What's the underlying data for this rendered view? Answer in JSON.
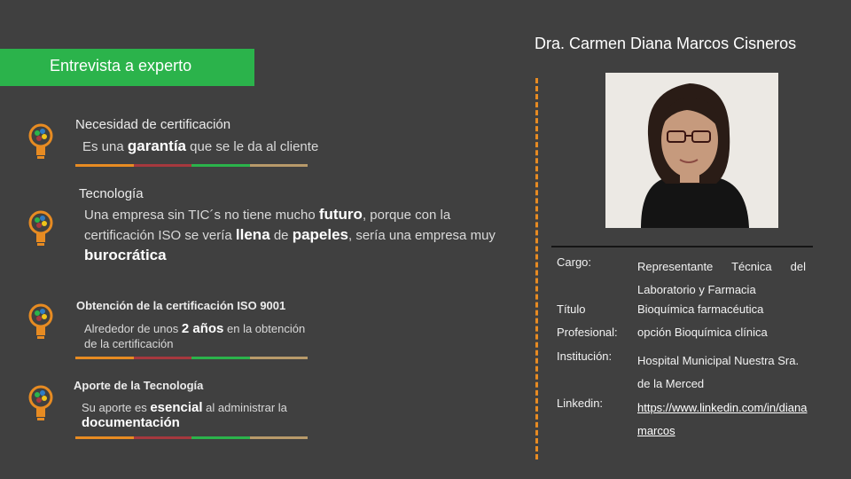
{
  "header": {
    "banner_text": "Entrevista a experto",
    "expert_name": "Dra. Carmen Diana Marcos Cisneros"
  },
  "colors": {
    "background": "#404040",
    "banner": "#2bb34b",
    "divider": "#e78b22",
    "stripe": [
      "#e78b22",
      "#a6383e",
      "#2bb34b",
      "#b89a6a"
    ]
  },
  "icons": [
    "lightbulb-icon",
    "lightbulb-icon",
    "lightbulb-icon",
    "lightbulb-icon"
  ],
  "topics": [
    {
      "title": "Necesidad de certificación",
      "parts": [
        "Es una ",
        "garantía",
        " que se le da al cliente"
      ]
    },
    {
      "title": "Tecnología",
      "parts": [
        "Una empresa sin TIC´s no tiene mucho ",
        "futuro",
        ", porque con la certificación ISO se vería ",
        "llena",
        " de ",
        "papeles",
        ", sería una empresa muy ",
        "burocrática"
      ]
    },
    {
      "title": "Obtención de la certificación ISO 9001",
      "parts": [
        "Alrededor de unos ",
        "2 años",
        " en la obtención de la certificación"
      ]
    },
    {
      "title": "Aporte de la Tecnología",
      "parts": [
        "Su aporte es ",
        "esencial",
        " al administrar la ",
        "documentación"
      ]
    }
  ],
  "profile": {
    "cargo_label": "Cargo:",
    "cargo_value": "Representante Técnica del Laboratorio y Farmacia",
    "titulo_label": "Título",
    "titulo_value": "Bioquímica farmacéutica",
    "profesional_label": "Profesional:",
    "profesional_value": "opción Bioquímica clínica",
    "institucion_label": "Institución:",
    "institucion_value": "Hospital Municipal Nuestra Sra. de la Merced",
    "linkedin_label": "Linkedin:",
    "linkedin_value": "https://www.linkedin.com/in/dianamarcos"
  }
}
